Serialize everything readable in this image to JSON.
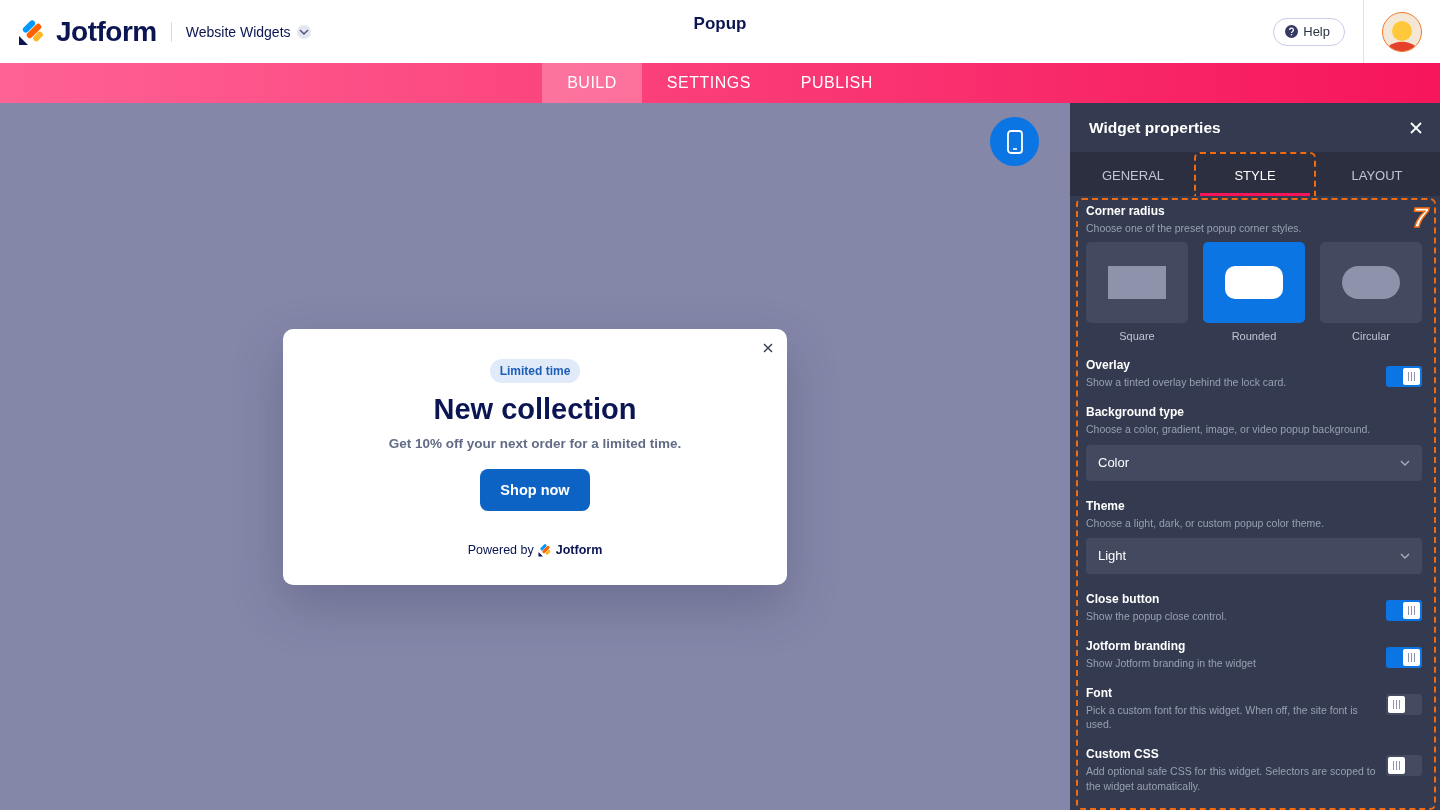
{
  "header": {
    "brand": "Jotform",
    "product": "Website Widgets",
    "title": "Popup",
    "help": "Help"
  },
  "nav_tabs": [
    {
      "label": "BUILD",
      "selected": true
    },
    {
      "label": "SETTINGS",
      "selected": false
    },
    {
      "label": "PUBLISH",
      "selected": false
    }
  ],
  "popup": {
    "badge": "Limited time",
    "heading": "New collection",
    "text": "Get 10% off your next order for a limited time.",
    "button": "Shop now",
    "powered_by": "Powered by",
    "powered_brand": "Jotform"
  },
  "panel": {
    "title": "Widget properties",
    "tabs": [
      {
        "label": "GENERAL",
        "selected": false,
        "annotated": false
      },
      {
        "label": "STYLE",
        "selected": true,
        "annotated": true
      },
      {
        "label": "LAYOUT",
        "selected": false,
        "annotated": false
      }
    ],
    "annotation": {
      "label": "7"
    },
    "corner_radius": {
      "title": "Corner radius",
      "description": "Choose one of the preset popup corner styles.",
      "options": [
        {
          "kind": "square",
          "label": "Square",
          "selected": false
        },
        {
          "kind": "rounded",
          "label": "Rounded",
          "selected": true
        },
        {
          "kind": "circular",
          "label": "Circular",
          "selected": false
        }
      ]
    },
    "settings": [
      {
        "kind": "toggle",
        "title": "Overlay",
        "description": "Show a tinted overlay behind the lock card.",
        "on": true
      },
      {
        "kind": "select",
        "title": "Background type",
        "description": "Choose a color, gradient, image, or video popup background.",
        "value": "Color"
      },
      {
        "kind": "select",
        "title": "Theme",
        "description": "Choose a light, dark, or custom popup color theme.",
        "value": "Light"
      },
      {
        "kind": "toggle",
        "title": "Close button",
        "description": "Show the popup close control.",
        "on": true
      },
      {
        "kind": "toggle",
        "title": "Jotform branding",
        "description": "Show Jotform branding in the widget",
        "on": true
      },
      {
        "kind": "toggle",
        "title": "Font",
        "description": "Pick a custom font for this widget. When off, the site font is used.",
        "on": false
      },
      {
        "kind": "toggle",
        "title": "Custom CSS",
        "description": "Add optional safe CSS for this widget. Selectors are scoped to the widget automatically.",
        "on": false
      }
    ]
  }
}
